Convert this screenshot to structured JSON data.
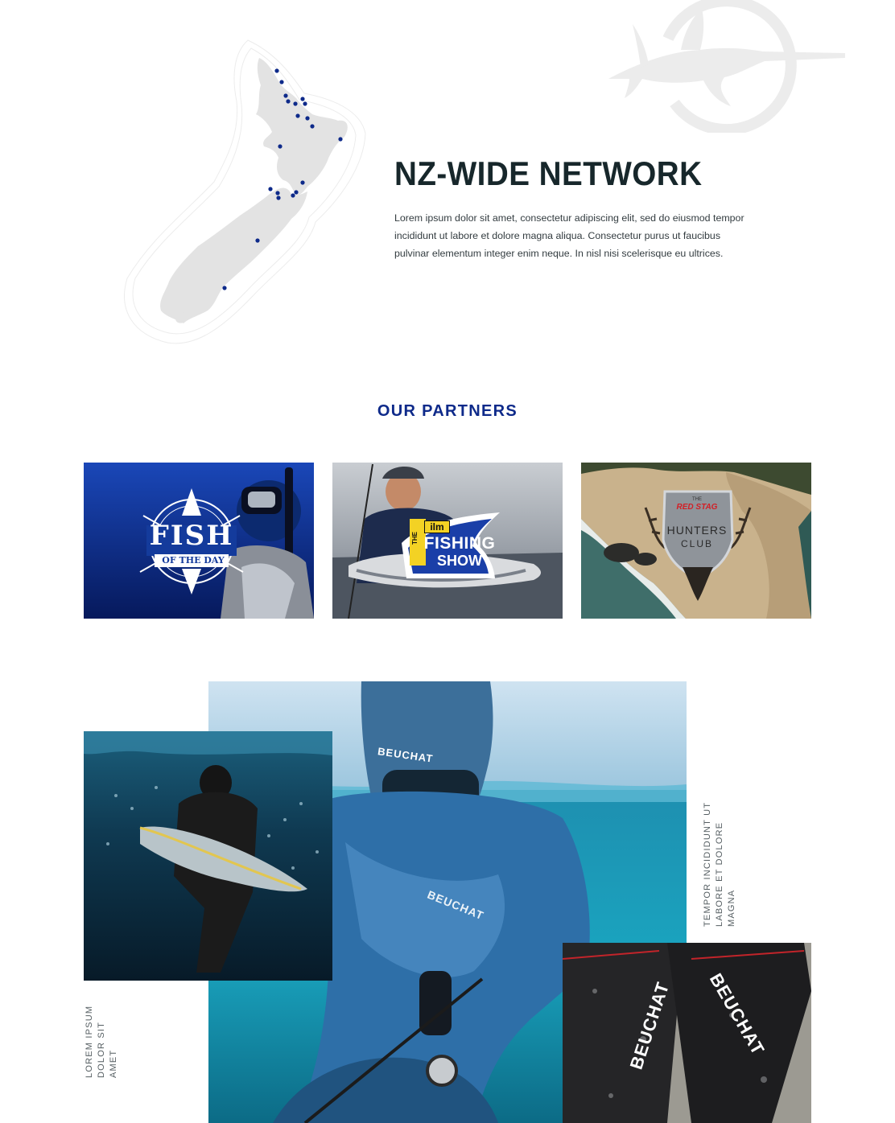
{
  "network": {
    "title": "NZ-WIDE NETWORK",
    "body": "Lorem ipsum dolor sit amet, consectetur adipiscing elit, sed do eiusmod tempor incididunt ut labore et dolore magna aliqua. Consectetur purus ut faucibus pulvinar elementum integer enim neque. In nisl nisi scelerisque eu ultrices.",
    "map_icon": "nz-map-icon",
    "watermark_icon": "swordfish-icon",
    "marker_color": "#0e2a8a"
  },
  "partners": {
    "heading": "OUR PARTNERS",
    "items": [
      {
        "name": "fish-of-the-day",
        "logo_line1": "FISH",
        "logo_line2": "OF THE DAY"
      },
      {
        "name": "ilm-fishing-show",
        "logo_top": "THE",
        "logo_brand": "ilm",
        "logo_line1": "FISHING",
        "logo_line2": "SHOW"
      },
      {
        "name": "red-stag-hunters-club",
        "logo_top": "THE",
        "logo_brand": "RED STAG",
        "logo_line1": "HUNTERS",
        "logo_line2": "CLUB"
      }
    ]
  },
  "gallery": {
    "caption_left": "LOREM IPSUM DOLOR SIT AMET",
    "caption_right": "TEMPOR INCIDIDUNT UT LABORE ET DOLORE MAGNA",
    "hood_brand": "BEUCHAT",
    "suit_brand": "BEUCHAT",
    "fin_brand_left": "BEUCHAT",
    "fin_brand_right": "BEUCHAT"
  },
  "colors": {
    "accent": "#0e2a8a",
    "heading": "#17272b",
    "map_fill": "#e3e3e3",
    "watermark": "#ececec"
  }
}
